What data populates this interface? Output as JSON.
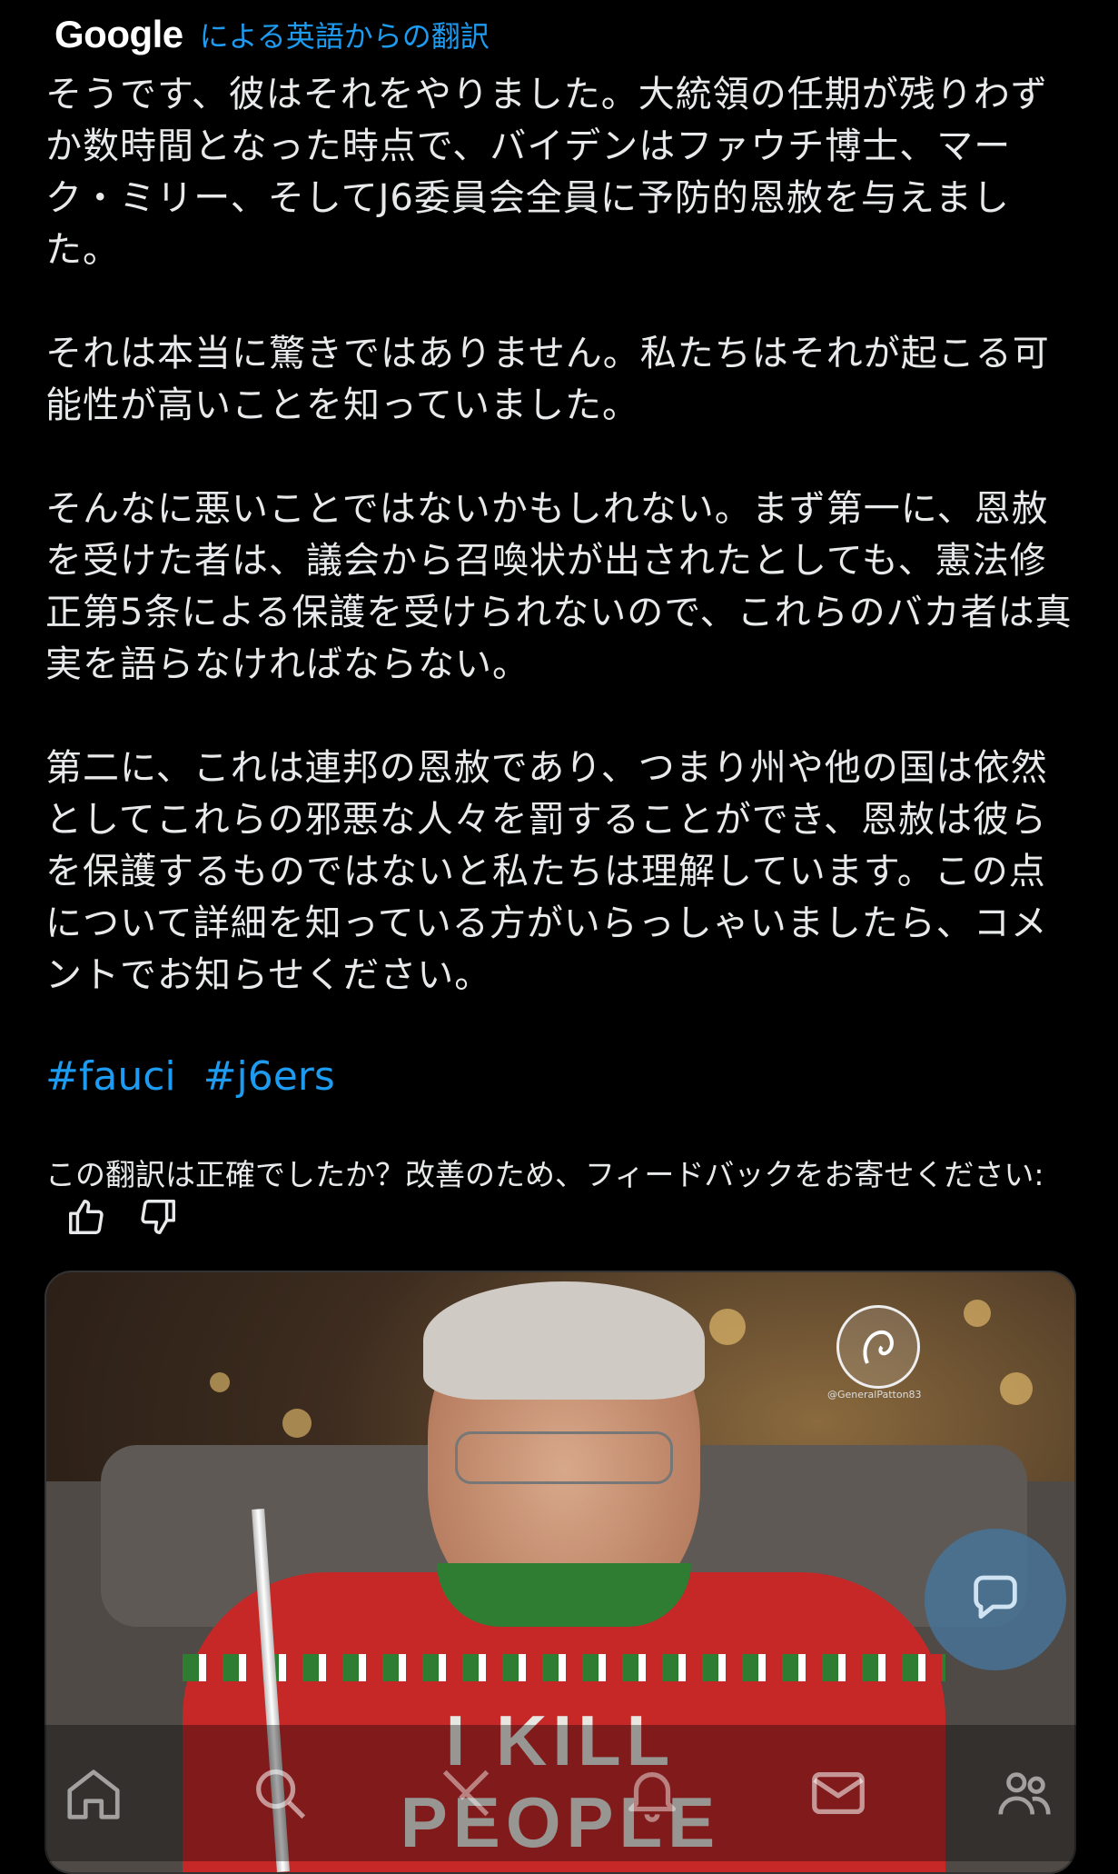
{
  "translation": {
    "provider": "Google",
    "label": "による英語からの翻訳"
  },
  "post": {
    "paragraphs": [
      "そうです、彼はそれをやりました。大統領の任期が残りわずか数時間となった時点で、バイデンはファウチ博士、マーク・ミリー、そしてJ6委員会全員に予防的恩赦を与えました。",
      "それは本当に驚きではありません。私たちはそれが起こる可能性が高いことを知っていました。",
      "そんなに悪いことではないかもしれない。まず第一に、恩赦を受けた者は、議会から召喚状が出されたとしても、憲法修正第5条による保護を受けられないので、これらのバカ者は真実を語らなければならない。",
      "第二に、これは連邦の恩赦であり、つまり州や他の国は依然としてこれらの邪悪な人々を罰することができ、恩赦は彼らを保護するものではないと私たちは理解しています。この点について詳細を知っている方がいらっしゃいましたら、コメントでお知らせください。"
    ],
    "hashtags": [
      "#fauci",
      "#j6ers"
    ]
  },
  "feedback": {
    "prompt": "この翻訳は正確でしたか？改善のため、フィードバックをお寄せください:",
    "like_icon": "thumbs-up-icon",
    "dislike_icon": "thumbs-down-icon"
  },
  "media": {
    "sweater_line1": "I KILL",
    "sweater_line2": "PEOPLE",
    "watermark": "@GeneralPatton83"
  },
  "fab": {
    "icon": "chat-bubble-icon"
  },
  "bottom_nav": {
    "items": [
      "home-icon",
      "search-icon",
      "grok-icon",
      "notifications-icon",
      "messages-icon",
      "communities-icon"
    ]
  },
  "colors": {
    "accent": "#1d9bf0",
    "background": "#000000",
    "text": "#e7e9ea"
  }
}
